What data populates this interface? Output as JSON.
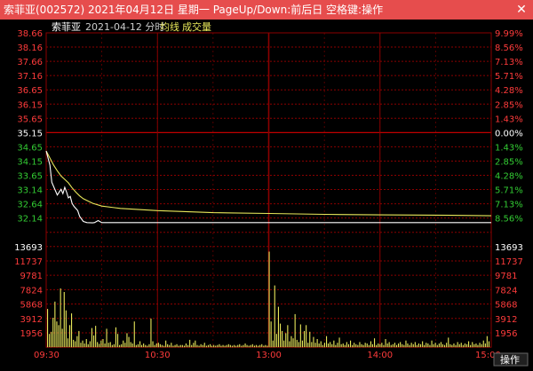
{
  "window": {
    "title": "索菲亚(002572) 2021年04月12日 星期一 PageUp/Down:前后日 空格键:操作",
    "close_icon": "close-icon"
  },
  "header": {
    "stock_name": "索菲亚",
    "date_label": "2021-04-12 分时",
    "avg_label": "均线",
    "volume_label": "成交量"
  },
  "bottom": {
    "operate_label": "操作"
  },
  "colors": {
    "up": "#ff3b3b",
    "down": "#33cc33",
    "neutral": "#ffffff",
    "price_line": "#ffffff",
    "avg_line": "#e8e85a",
    "volume": "#e8e85a",
    "grid": "#8b0000",
    "axis_time": "#ff3b3b"
  },
  "chart_data": {
    "type": "line",
    "pre_close": 35.15,
    "price_axis": {
      "left_labels": [
        "38.66",
        "38.16",
        "37.66",
        "37.16",
        "36.65",
        "36.15",
        "35.65",
        "35.15",
        "34.65",
        "34.15",
        "33.65",
        "33.14",
        "32.64",
        "32.14"
      ],
      "right_labels": [
        "9.99%",
        "8.56%",
        "7.13%",
        "5.71%",
        "4.28%",
        "2.85%",
        "1.43%",
        "0.00%",
        "1.43%",
        "2.85%",
        "4.28%",
        "5.71%",
        "7.13%",
        "8.56%"
      ],
      "ylim": [
        32.14,
        38.66
      ]
    },
    "volume_axis": {
      "labels": [
        "13693",
        "11737",
        "9781",
        "7824",
        "5868",
        "3912",
        "1956"
      ],
      "ylim": [
        0,
        13693
      ]
    },
    "x_labels": [
      "09:30",
      "10:30",
      "13:00",
      "14:00",
      "15:00"
    ],
    "series": [
      {
        "name": "均线",
        "x": [
          0,
          2,
          4,
          6,
          8,
          10,
          12,
          14,
          16,
          18,
          20,
          25,
          30,
          40,
          60,
          90,
          120,
          150,
          180,
          210,
          240
        ],
        "values": [
          34.5,
          34.25,
          34.0,
          33.8,
          33.62,
          33.5,
          33.38,
          33.2,
          33.05,
          32.92,
          32.82,
          32.66,
          32.56,
          32.48,
          32.4,
          32.33,
          32.3,
          32.27,
          32.25,
          32.24,
          32.22
        ]
      },
      {
        "name": "",
        "x": [
          0,
          2,
          3,
          5,
          6,
          8,
          9,
          10,
          11,
          12,
          13,
          14,
          15,
          17,
          18,
          20,
          22,
          25,
          26,
          28,
          30,
          40,
          60,
          90,
          120,
          150,
          180,
          210,
          240
        ],
        "values": [
          34.5,
          34.0,
          33.4,
          33.1,
          32.95,
          33.15,
          33.0,
          33.22,
          33.05,
          32.85,
          32.9,
          32.65,
          32.55,
          32.4,
          32.2,
          32.02,
          31.98,
          31.97,
          31.98,
          32.05,
          31.98,
          31.98,
          31.98,
          31.98,
          31.98,
          31.98,
          31.98,
          31.98,
          31.98
        ]
      }
    ],
    "volume": [
      5200,
      1800,
      2100,
      4000,
      6200,
      3500,
      3000,
      8000,
      2500,
      7500,
      5000,
      1200,
      3000,
      4600,
      1000,
      800,
      1500,
      2200,
      600,
      900,
      500,
      1100,
      400,
      800,
      2600,
      1600,
      2900,
      700,
      450,
      900,
      1100,
      500,
      2500,
      600,
      700,
      300,
      400,
      2700,
      1800,
      300,
      400,
      900,
      600,
      1900,
      1400,
      700,
      500,
      3500,
      300,
      400,
      800,
      300,
      500,
      300,
      200,
      400,
      3900,
      800,
      300,
      500,
      600,
      400,
      300,
      200,
      900,
      400,
      300,
      600,
      200,
      300,
      400,
      200,
      300,
      300,
      200,
      500,
      300,
      1000,
      300,
      600,
      900,
      300,
      200,
      400,
      300,
      600,
      200,
      300,
      400,
      200,
      300,
      200,
      300,
      400,
      200,
      300,
      200,
      300,
      400,
      300,
      200,
      300,
      200,
      300,
      400,
      200,
      300,
      500,
      300,
      200,
      300,
      400,
      200,
      300,
      200,
      300,
      400,
      200,
      300,
      200,
      13000,
      3500,
      900,
      8400,
      1800,
      5500,
      3200,
      2200,
      900,
      1900,
      3000,
      800,
      1500,
      1200,
      4500,
      1000,
      700,
      3100,
      900,
      2200,
      3000,
      600,
      2100,
      700,
      1400,
      600,
      1100,
      500,
      800,
      300,
      600,
      1500,
      500,
      700,
      400,
      900,
      300,
      600,
      1300,
      400,
      500,
      300,
      700,
      400,
      900,
      300,
      600,
      400,
      300,
      700,
      400,
      300,
      600,
      500,
      300,
      800,
      400,
      1200,
      300,
      500,
      400,
      600,
      300,
      1100,
      500,
      700,
      300,
      400,
      600,
      300,
      500,
      700,
      400,
      300,
      900,
      500,
      300,
      600,
      400,
      700,
      300,
      500,
      400,
      800,
      300,
      600,
      500,
      300,
      900,
      400,
      600,
      300,
      500,
      700,
      400,
      300,
      600,
      1300,
      400,
      300,
      500,
      300,
      700,
      400,
      600,
      300,
      500,
      400,
      800,
      300,
      700,
      400,
      500,
      300,
      600,
      400,
      900,
      500,
      1500,
      800
    ]
  }
}
